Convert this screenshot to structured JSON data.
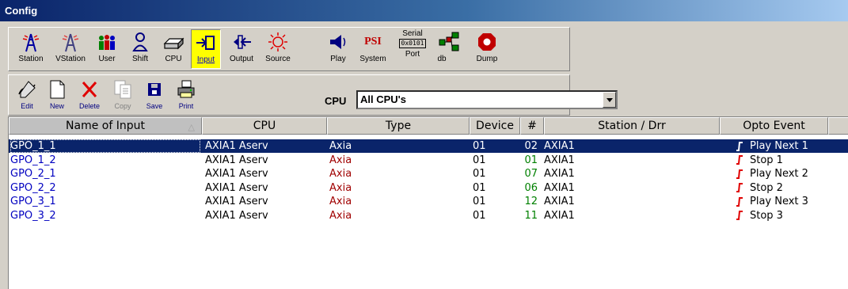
{
  "window": {
    "title": "Config"
  },
  "toolbar1": [
    {
      "name": "station",
      "label": "Station"
    },
    {
      "name": "vstation",
      "label": "VStation"
    },
    {
      "name": "user",
      "label": "User"
    },
    {
      "name": "shift",
      "label": "Shift"
    },
    {
      "name": "cpu",
      "label": "CPU"
    },
    {
      "name": "input",
      "label": "Input",
      "active": true
    },
    {
      "name": "output",
      "label": "Output"
    },
    {
      "name": "source",
      "label": "Source"
    },
    {
      "name": "play",
      "label": "Play"
    },
    {
      "name": "system",
      "label": "System",
      "icon_text": "PSI"
    },
    {
      "name": "serial-port",
      "label": "Port",
      "top_label": "Serial",
      "icon_text": "0x0101"
    },
    {
      "name": "db",
      "label": "db"
    },
    {
      "name": "dump",
      "label": "Dump"
    }
  ],
  "toolbar2": [
    {
      "name": "edit",
      "label": "Edit"
    },
    {
      "name": "new",
      "label": "New"
    },
    {
      "name": "delete",
      "label": "Delete"
    },
    {
      "name": "copy",
      "label": "Copy",
      "disabled": true
    },
    {
      "name": "save",
      "label": "Save"
    },
    {
      "name": "print",
      "label": "Print"
    }
  ],
  "cpu_filter": {
    "label": "CPU",
    "value": "All CPU's"
  },
  "table": {
    "columns": [
      "Name of Input",
      "CPU",
      "Type",
      "Device",
      "#",
      "Station / Drr",
      "Opto Event"
    ],
    "rows": [
      {
        "name": "GPO_1_1",
        "cpu": "AXIA1 Aserv",
        "type": "Axia",
        "device": "01",
        "num": "02",
        "station": "AXIA1",
        "event": "Play Next 1",
        "selected": true
      },
      {
        "name": "GPO_1_2",
        "cpu": "AXIA1 Aserv",
        "type": "Axia",
        "device": "01",
        "num": "01",
        "station": "AXIA1",
        "event": "Stop 1"
      },
      {
        "name": "GPO_2_1",
        "cpu": "AXIA1 Aserv",
        "type": "Axia",
        "device": "01",
        "num": "07",
        "station": "AXIA1",
        "event": "Play Next 2"
      },
      {
        "name": "GPO_2_2",
        "cpu": "AXIA1 Aserv",
        "type": "Axia",
        "device": "01",
        "num": "06",
        "station": "AXIA1",
        "event": "Stop 2"
      },
      {
        "name": "GPO_3_1",
        "cpu": "AXIA1 Aserv",
        "type": "Axia",
        "device": "01",
        "num": "12",
        "station": "AXIA1",
        "event": "Play Next 3"
      },
      {
        "name": "GPO_3_2",
        "cpu": "AXIA1 Aserv",
        "type": "Axia",
        "device": "01",
        "num": "11",
        "station": "AXIA1",
        "event": "Stop 3"
      }
    ]
  },
  "colors": {
    "selection": "#0a246a",
    "name_text": "#0000c0",
    "type_text": "#a00000",
    "num_text": "#008000",
    "event_icon": "#e00000",
    "active_button": "#ffff00"
  }
}
